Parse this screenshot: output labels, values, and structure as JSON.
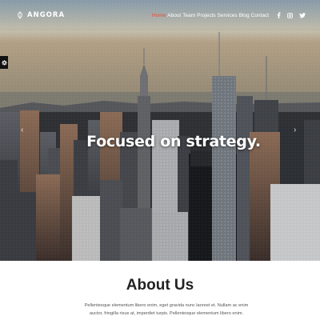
{
  "brand": {
    "name": "ANGORA",
    "logo_icon": "angora-logo-icon"
  },
  "nav": {
    "items": [
      {
        "label": "Home",
        "active": true
      },
      {
        "label": "About",
        "active": false
      },
      {
        "label": "Team",
        "active": false
      },
      {
        "label": "Projects",
        "active": false
      },
      {
        "label": "Services",
        "active": false
      },
      {
        "label": "Blog",
        "active": false
      },
      {
        "label": "Contact",
        "active": false
      }
    ],
    "social": [
      {
        "icon": "facebook-icon",
        "glyph": "f"
      },
      {
        "icon": "instagram-icon",
        "glyph": "◎"
      },
      {
        "icon": "twitter-icon",
        "glyph": "🐦"
      }
    ]
  },
  "hero": {
    "title": "Focused on strategy.",
    "prev_glyph": "‹",
    "next_glyph": "›"
  },
  "about": {
    "heading": "About Us",
    "text": "Pellentesque elementum libero enim, eget gravida nunc laoreet et. Nullam ac enim auctor, fringilla risus at, imperdiet turpis. Pellentesque elementum libero enim."
  },
  "colors": {
    "accent": "#e74c3c",
    "text_dark": "#222222"
  }
}
